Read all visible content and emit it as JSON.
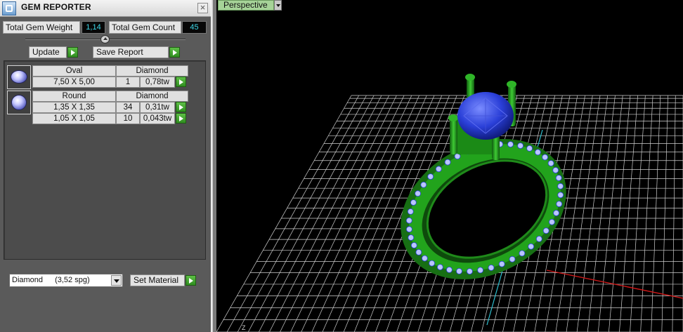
{
  "window": {
    "title": "GEM REPORTER",
    "close_glyph": "×"
  },
  "stats": {
    "total_weight_label": "Total Gem Weight",
    "total_weight_value": "1,14",
    "total_count_label": "Total Gem Count",
    "total_count_value": "45"
  },
  "actions": {
    "update_label": "Update",
    "save_report_label": "Save Report",
    "set_material_label": "Set Material"
  },
  "gem_groups": [
    {
      "shape": "Oval",
      "material": "Diamond",
      "rows": [
        {
          "size": "7,50 X 5,00",
          "count": "1",
          "weight": "0,78tw"
        }
      ]
    },
    {
      "shape": "Round",
      "material": "Diamond",
      "rows": [
        {
          "size": "1,35 X 1,35",
          "count": "34",
          "weight": "0,31tw"
        },
        {
          "size": "1,05 X 1,05",
          "count": "10",
          "weight": "0,043tw"
        }
      ]
    }
  ],
  "material_select": {
    "name": "Diamond",
    "density": "(3,52 spg)"
  },
  "viewport": {
    "view_label": "Perspective",
    "axis_label": "Z",
    "ring_color": "#1f9a1a",
    "gem_color": "#2a3fd8",
    "grid_color": "#cfcfcf"
  },
  "icons": [
    "app-icon",
    "close-icon",
    "slider-thumb-icon",
    "go-arrow-icon",
    "oval-gem-icon",
    "round-gem-icon",
    "dropdown-arrow-icon"
  ]
}
